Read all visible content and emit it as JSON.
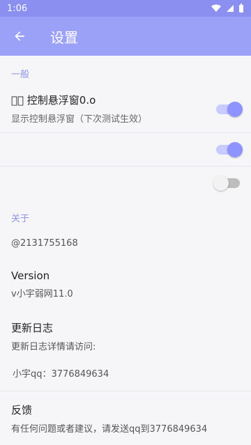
{
  "status": {
    "time": "1:06"
  },
  "appbar": {
    "title": "设置"
  },
  "sections": {
    "general": "一般",
    "about": "关于"
  },
  "prefs": {
    "floating": {
      "title": "󰀀󰀀 控制悬浮窗0.o",
      "summary": "显示控制悬浮窗（下次测试生效）"
    }
  },
  "about": {
    "id": "@2131755168",
    "version_title": "Version",
    "version_value": "v小宇弱网11.0",
    "changelog_title": "更新日志",
    "changelog_summary": "更新日志详情请访问:",
    "qq_line": "小宇qq：3776849634",
    "feedback_title": "反馈",
    "feedback_summary": "有任何问题或者建议，请发送qq到3776849634"
  },
  "colors": {
    "accent": "#9aa1f6",
    "section": "#8e93e6"
  }
}
